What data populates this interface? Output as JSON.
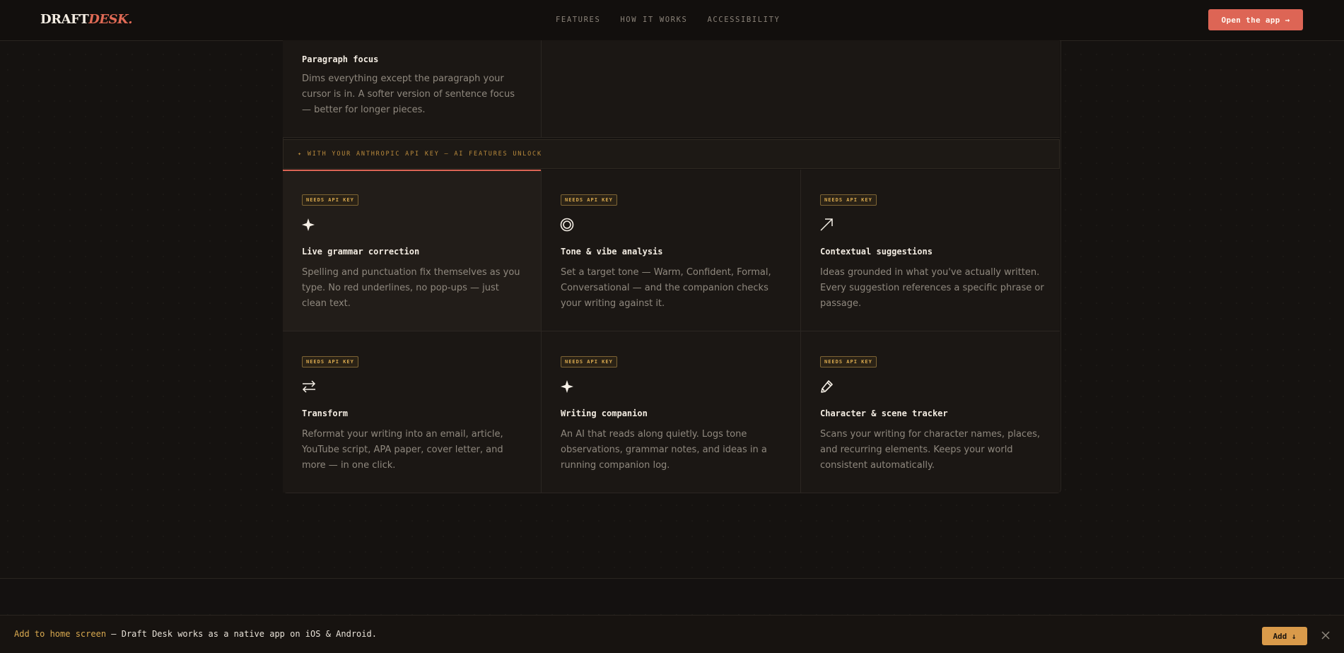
{
  "nav": {
    "logo_main": "DRAFT",
    "logo_accent": "DESK.",
    "links": [
      "FEATURES",
      "HOW IT WORKS",
      "ACCESSIBILITY"
    ],
    "cta": "Open the app →"
  },
  "top_card": {
    "title": "Paragraph focus",
    "desc": "Dims everything except the paragraph your cursor is in. A softer version of sentence focus — better for longer pieces."
  },
  "banner": "✦ WITH YOUR ANTHROPIC API KEY — AI FEATURES UNLOCK",
  "features": [
    {
      "badge": "NEEDS API KEY",
      "icon": "sparkle-icon",
      "title": "Live grammar correction",
      "desc": "Spelling and punctuation fix themselves as you type. No red underlines, no pop-ups — just clean text."
    },
    {
      "badge": "NEEDS API KEY",
      "icon": "target-icon",
      "title": "Tone & vibe analysis",
      "desc": "Set a target tone — Warm, Confident, Formal, Conversational — and the companion checks your writing against it."
    },
    {
      "badge": "NEEDS API KEY",
      "icon": "arrow-up-right-icon",
      "title": "Contextual suggestions",
      "desc": "Ideas grounded in what you've actually written. Every suggestion references a specific phrase or passage."
    },
    {
      "badge": "NEEDS API KEY",
      "icon": "swap-arrows-icon",
      "title": "Transform",
      "desc": "Reformat your writing into an email, article, YouTube script, APA paper, cover letter, and more — in one click."
    },
    {
      "badge": "NEEDS API KEY",
      "icon": "sparkle-icon",
      "title": "Writing companion",
      "desc": "An AI that reads along quietly. Logs tone observations, grammar notes, and ideas in a running companion log."
    },
    {
      "badge": "NEEDS API KEY",
      "icon": "pencil-icon",
      "title": "Character & scene tracker",
      "desc": "Scans your writing for character names, places, and recurring elements. Keeps your world consistent automatically."
    }
  ],
  "install": {
    "highlight": "Add to home screen",
    "text": " — Draft Desk works as a native app on iOS & Android.",
    "button": "Add ↓"
  },
  "colors": {
    "accent": "#dd6555",
    "badge": "#d9a94f",
    "background": "#151210"
  }
}
